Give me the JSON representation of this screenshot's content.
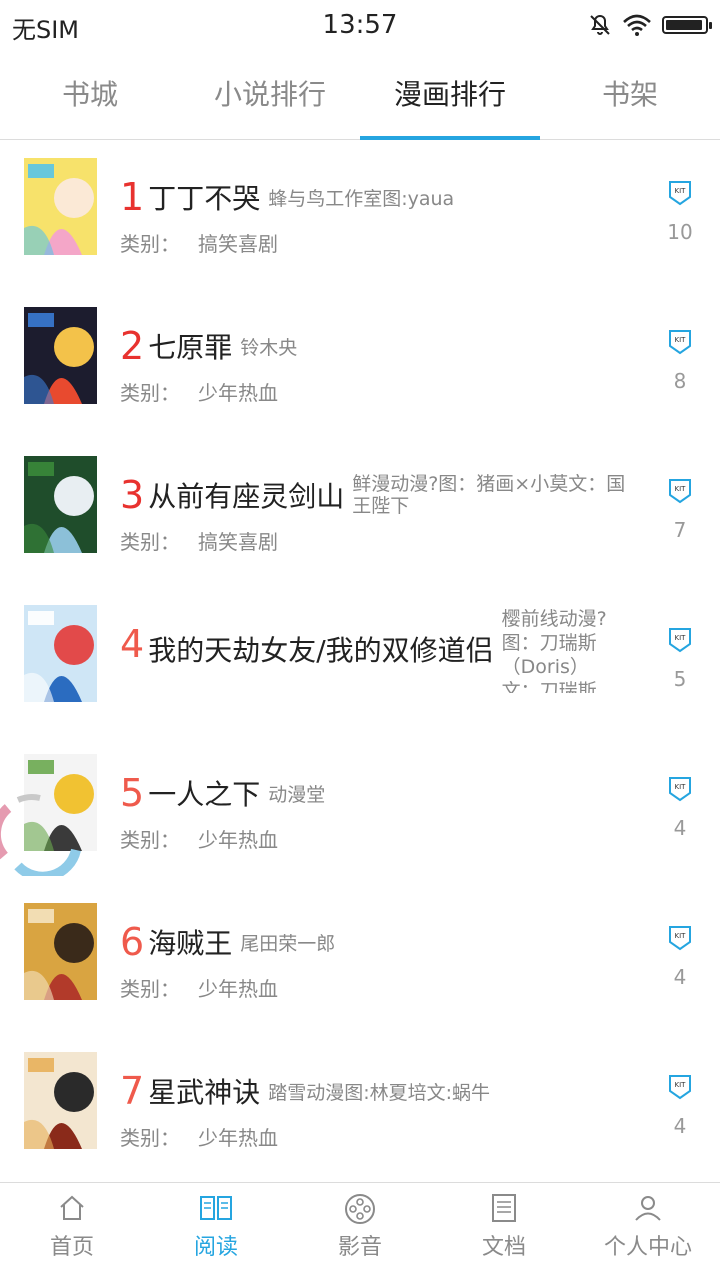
{
  "status": {
    "carrier": "无SIM",
    "time": "13:57",
    "battery_level": 0.95
  },
  "tabs": [
    {
      "label": "书城",
      "active": false
    },
    {
      "label": "小说排行",
      "active": false
    },
    {
      "label": "漫画排行",
      "active": true
    },
    {
      "label": "书架",
      "active": false
    }
  ],
  "category_key": "类别：",
  "items": [
    {
      "rank": "1",
      "title": "丁丁不哭",
      "author": "蜂与鸟工作室图:yaua",
      "category": "搞笑喜剧",
      "count": "10"
    },
    {
      "rank": "2",
      "title": "七原罪",
      "author": "铃木央",
      "category": "少年热血",
      "count": "8"
    },
    {
      "rank": "3",
      "title": "从前有座灵剑山",
      "author": "鲜漫动漫?图：猪画×小莫文：国王陛下",
      "category": "搞笑喜剧",
      "count": "7"
    },
    {
      "rank": "4",
      "title": "我的天劫女友/我的双修道侣",
      "author": "樱前线动漫?图：刀瑞斯（Doris）文：刀瑞斯",
      "category": "",
      "count": "5"
    },
    {
      "rank": "5",
      "title": "一人之下",
      "author": "动漫堂",
      "category": "少年热血",
      "count": "4"
    },
    {
      "rank": "6",
      "title": "海贼王",
      "author": "尾田荣一郎",
      "category": "少年热血",
      "count": "4"
    },
    {
      "rank": "7",
      "title": "星武神诀",
      "author": "踏雪动漫图:林夏培文:蜗牛",
      "category": "少年热血",
      "count": "4"
    }
  ],
  "colors": {
    "accent": "#25a5e0",
    "rank_red": "#e8322f"
  },
  "badge_text": "KIT",
  "bottom_nav": [
    {
      "label": "首页",
      "icon": "home-icon",
      "active": false
    },
    {
      "label": "阅读",
      "icon": "book-icon",
      "active": true
    },
    {
      "label": "影音",
      "icon": "film-reel-icon",
      "active": false
    },
    {
      "label": "文档",
      "icon": "document-icon",
      "active": false
    },
    {
      "label": "个人中心",
      "icon": "user-icon",
      "active": false
    }
  ]
}
